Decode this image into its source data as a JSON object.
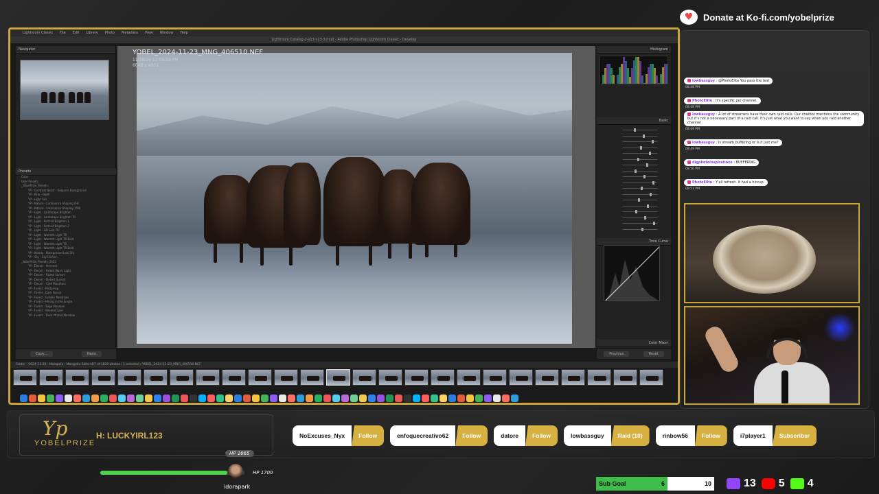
{
  "donate": {
    "text": "Donate at Ko-fi.com/yobelprize"
  },
  "lightroom": {
    "menubar": [
      "Lightroom Classic",
      "File",
      "Edit",
      "Library",
      "Photo",
      "Metadata",
      "View",
      "Window",
      "Help"
    ],
    "titlebar": "Lightroom Catalog-2-v13-v13-3.lrcat - Adobe Photoshop Lightroom Classic - Develop",
    "left_panel": {
      "navigator_label": "Navigator",
      "presets_label": "Presets",
      "presets": [
        "Color",
        "User Presets",
        "_YobelPrize_Presets",
        "YP - Contrast Boost - Subjects Background",
        "YP - Pink - B&W",
        "YP - Light Fall",
        "YP - Nature - Luminance Shaping R-B",
        "YP - Nature - Luminance Shaping 15W",
        "YP - Light - Landscape Brighten",
        "YP - Light - Landscape Brighten TR",
        "YP - Light - Portrait Brighten 1",
        "YP - Light - Portrait Brighten 2",
        "YP - Light - GR Skin TR",
        "YP - Light - Warmth Light TR",
        "YP - Light - Warmth Light TR Bold",
        "YP - Light - Warmth Light TR",
        "YP - Light - Warmth Light TR Bold",
        "YP - Moody - Background Low Sky",
        "YP - Sky - Sky Darken",
        "_YobelPrize_Presets_2022",
        "YP - Desert - Harness",
        "YP - Desert - Faded Warm Light",
        "YP - Desert - Faded Sunset",
        "YP - Desert - Desert Sunset",
        "YP - Desert - Cold Mountain",
        "YP - Forest - Misty Fog",
        "YP - Forest - Dark Forest",
        "YP - Forest - Golden Meadows",
        "YP - Forest - Hiking in the Jungle",
        "YP - Forest - Sage Meadow",
        "YP - Forest - Shaded Lake",
        "YP - Forest - Thick Misted Meadow"
      ],
      "copy_btn": "Copy...",
      "paste_btn": "Paste"
    },
    "image": {
      "filename": "YOBEL_2024-11-23_MNG_406510.NEF",
      "date": "11/28/24 12:59:59 PM",
      "dims": "6048 x 4032"
    },
    "right_panel": {
      "histogram_label": "Histogram",
      "basic_label": "Basic",
      "tone_curve_label": "Tone Curve",
      "color_mixer_label": "Color Mixer",
      "previous_btn": "Previous",
      "reset_btn": "Reset"
    },
    "filmstrip_info": "Folder : 2024-11-28 - Mongolia - Mongolia Edits 407 of 1020 photos / 1 selected / YOBEL_2024-11-23_MNG_406510.NEF"
  },
  "chat": [
    {
      "user": "lowbassguy",
      "text": "@PhotoElite You pass the test",
      "time": "08:48 PM"
    },
    {
      "user": "PhotoElite",
      "text": "It's specific per channel.",
      "time": "08:48 PM"
    },
    {
      "user": "lowbassguy",
      "text": "A lot of streamers have their own raid calls. Our chatbot mentions the community but it's not a necessary part of a raid call. It's just what you want to say when you raid another channel",
      "time": "08:49 PM"
    },
    {
      "user": "lowbassguy",
      "text": "Is stream buffering or is it just me?",
      "time": "08:49 PM"
    },
    {
      "user": "digphotoinspirations",
      "text": "BUFFERING",
      "time": "08:50 PM"
    },
    {
      "user": "PhotoElite",
      "text": "Y'all refresh. It had a hiccup.",
      "time": "08:51 PM"
    }
  ],
  "overlay": {
    "logo_mark": "Yp",
    "logo_name": "YOBELPRIZE",
    "ticker": "H: LUCKYIRL123",
    "hp_top": "HP 1665",
    "hp_right": "HP 1700",
    "hp_fraction": 0.98,
    "hp_user": "idorapark"
  },
  "events": [
    {
      "name": "NoExcuses_Nyx",
      "type": "Follow"
    },
    {
      "name": "enfoquecreativo62",
      "type": "Follow"
    },
    {
      "name": "datore",
      "type": "Follow"
    },
    {
      "name": "lowbassguy",
      "type": "Raid (10)"
    },
    {
      "name": "rinbow56",
      "type": "Follow"
    },
    {
      "name": "i7player1",
      "type": "Subscriber"
    }
  ],
  "subgoal": {
    "label": "Sub Goal",
    "current": "6",
    "target": "10"
  },
  "stats": {
    "twitch": "13",
    "youtube": "5",
    "kick": "4"
  },
  "colors": {
    "gold": "#c9a53b",
    "twitch": "#9146ff",
    "youtube": "#ff0000",
    "kick": "#53fc18",
    "goal_green": "#3fbd4a"
  }
}
